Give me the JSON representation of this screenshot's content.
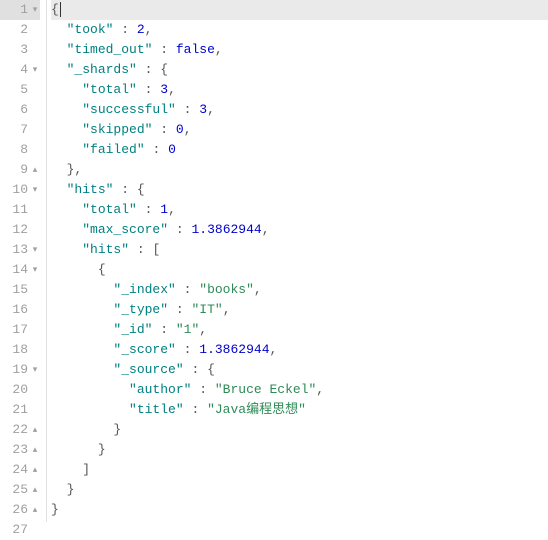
{
  "lines": [
    {
      "n": 1,
      "fold": "▾",
      "active": true,
      "tokens": [
        {
          "t": "brace",
          "v": "{"
        }
      ],
      "cursor_after": 0
    },
    {
      "n": 2,
      "fold": "",
      "active": false,
      "tokens": [
        {
          "t": "plain",
          "v": "  "
        },
        {
          "t": "key",
          "v": "\"took\""
        },
        {
          "t": "plain",
          "v": " "
        },
        {
          "t": "colon-sep",
          "v": ":"
        },
        {
          "t": "plain",
          "v": " "
        },
        {
          "t": "number",
          "v": "2"
        },
        {
          "t": "comma",
          "v": ","
        }
      ]
    },
    {
      "n": 3,
      "fold": "",
      "active": false,
      "tokens": [
        {
          "t": "plain",
          "v": "  "
        },
        {
          "t": "key",
          "v": "\"timed_out\""
        },
        {
          "t": "plain",
          "v": " "
        },
        {
          "t": "colon-sep",
          "v": ":"
        },
        {
          "t": "plain",
          "v": " "
        },
        {
          "t": "kw",
          "v": "false"
        },
        {
          "t": "comma",
          "v": ","
        }
      ]
    },
    {
      "n": 4,
      "fold": "▾",
      "active": false,
      "tokens": [
        {
          "t": "plain",
          "v": "  "
        },
        {
          "t": "key",
          "v": "\"_shards\""
        },
        {
          "t": "plain",
          "v": " "
        },
        {
          "t": "colon-sep",
          "v": ":"
        },
        {
          "t": "plain",
          "v": " "
        },
        {
          "t": "brace",
          "v": "{"
        }
      ]
    },
    {
      "n": 5,
      "fold": "",
      "active": false,
      "tokens": [
        {
          "t": "plain",
          "v": "    "
        },
        {
          "t": "key",
          "v": "\"total\""
        },
        {
          "t": "plain",
          "v": " "
        },
        {
          "t": "colon-sep",
          "v": ":"
        },
        {
          "t": "plain",
          "v": " "
        },
        {
          "t": "number",
          "v": "3"
        },
        {
          "t": "comma",
          "v": ","
        }
      ]
    },
    {
      "n": 6,
      "fold": "",
      "active": false,
      "tokens": [
        {
          "t": "plain",
          "v": "    "
        },
        {
          "t": "key",
          "v": "\"successful\""
        },
        {
          "t": "plain",
          "v": " "
        },
        {
          "t": "colon-sep",
          "v": ":"
        },
        {
          "t": "plain",
          "v": " "
        },
        {
          "t": "number",
          "v": "3"
        },
        {
          "t": "comma",
          "v": ","
        }
      ]
    },
    {
      "n": 7,
      "fold": "",
      "active": false,
      "tokens": [
        {
          "t": "plain",
          "v": "    "
        },
        {
          "t": "key",
          "v": "\"skipped\""
        },
        {
          "t": "plain",
          "v": " "
        },
        {
          "t": "colon-sep",
          "v": ":"
        },
        {
          "t": "plain",
          "v": " "
        },
        {
          "t": "number",
          "v": "0"
        },
        {
          "t": "comma",
          "v": ","
        }
      ]
    },
    {
      "n": 8,
      "fold": "",
      "active": false,
      "tokens": [
        {
          "t": "plain",
          "v": "    "
        },
        {
          "t": "key",
          "v": "\"failed\""
        },
        {
          "t": "plain",
          "v": " "
        },
        {
          "t": "colon-sep",
          "v": ":"
        },
        {
          "t": "plain",
          "v": " "
        },
        {
          "t": "number",
          "v": "0"
        }
      ]
    },
    {
      "n": 9,
      "fold": "▴",
      "active": false,
      "tokens": [
        {
          "t": "plain",
          "v": "  "
        },
        {
          "t": "brace",
          "v": "}"
        },
        {
          "t": "comma",
          "v": ","
        }
      ]
    },
    {
      "n": 10,
      "fold": "▾",
      "active": false,
      "tokens": [
        {
          "t": "plain",
          "v": "  "
        },
        {
          "t": "key",
          "v": "\"hits\""
        },
        {
          "t": "plain",
          "v": " "
        },
        {
          "t": "colon-sep",
          "v": ":"
        },
        {
          "t": "plain",
          "v": " "
        },
        {
          "t": "brace",
          "v": "{"
        }
      ]
    },
    {
      "n": 11,
      "fold": "",
      "active": false,
      "tokens": [
        {
          "t": "plain",
          "v": "    "
        },
        {
          "t": "key",
          "v": "\"total\""
        },
        {
          "t": "plain",
          "v": " "
        },
        {
          "t": "colon-sep",
          "v": ":"
        },
        {
          "t": "plain",
          "v": " "
        },
        {
          "t": "number",
          "v": "1"
        },
        {
          "t": "comma",
          "v": ","
        }
      ]
    },
    {
      "n": 12,
      "fold": "",
      "active": false,
      "tokens": [
        {
          "t": "plain",
          "v": "    "
        },
        {
          "t": "key",
          "v": "\"max_score\""
        },
        {
          "t": "plain",
          "v": " "
        },
        {
          "t": "colon-sep",
          "v": ":"
        },
        {
          "t": "plain",
          "v": " "
        },
        {
          "t": "number",
          "v": "1.3862944"
        },
        {
          "t": "comma",
          "v": ","
        }
      ]
    },
    {
      "n": 13,
      "fold": "▾",
      "active": false,
      "tokens": [
        {
          "t": "plain",
          "v": "    "
        },
        {
          "t": "key",
          "v": "\"hits\""
        },
        {
          "t": "plain",
          "v": " "
        },
        {
          "t": "colon-sep",
          "v": ":"
        },
        {
          "t": "plain",
          "v": " "
        },
        {
          "t": "bracket",
          "v": "["
        }
      ]
    },
    {
      "n": 14,
      "fold": "▾",
      "active": false,
      "tokens": [
        {
          "t": "plain",
          "v": "      "
        },
        {
          "t": "brace",
          "v": "{"
        }
      ]
    },
    {
      "n": 15,
      "fold": "",
      "active": false,
      "tokens": [
        {
          "t": "plain",
          "v": "        "
        },
        {
          "t": "key",
          "v": "\"_index\""
        },
        {
          "t": "plain",
          "v": " "
        },
        {
          "t": "colon-sep",
          "v": ":"
        },
        {
          "t": "plain",
          "v": " "
        },
        {
          "t": "string",
          "v": "\"books\""
        },
        {
          "t": "comma",
          "v": ","
        }
      ]
    },
    {
      "n": 16,
      "fold": "",
      "active": false,
      "tokens": [
        {
          "t": "plain",
          "v": "        "
        },
        {
          "t": "key",
          "v": "\"_type\""
        },
        {
          "t": "plain",
          "v": " "
        },
        {
          "t": "colon-sep",
          "v": ":"
        },
        {
          "t": "plain",
          "v": " "
        },
        {
          "t": "string",
          "v": "\"IT\""
        },
        {
          "t": "comma",
          "v": ","
        }
      ]
    },
    {
      "n": 17,
      "fold": "",
      "active": false,
      "tokens": [
        {
          "t": "plain",
          "v": "        "
        },
        {
          "t": "key",
          "v": "\"_id\""
        },
        {
          "t": "plain",
          "v": " "
        },
        {
          "t": "colon-sep",
          "v": ":"
        },
        {
          "t": "plain",
          "v": " "
        },
        {
          "t": "string",
          "v": "\"1\""
        },
        {
          "t": "comma",
          "v": ","
        }
      ]
    },
    {
      "n": 18,
      "fold": "",
      "active": false,
      "tokens": [
        {
          "t": "plain",
          "v": "        "
        },
        {
          "t": "key",
          "v": "\"_score\""
        },
        {
          "t": "plain",
          "v": " "
        },
        {
          "t": "colon-sep",
          "v": ":"
        },
        {
          "t": "plain",
          "v": " "
        },
        {
          "t": "number",
          "v": "1.3862944"
        },
        {
          "t": "comma",
          "v": ","
        }
      ]
    },
    {
      "n": 19,
      "fold": "▾",
      "active": false,
      "tokens": [
        {
          "t": "plain",
          "v": "        "
        },
        {
          "t": "key",
          "v": "\"_source\""
        },
        {
          "t": "plain",
          "v": " "
        },
        {
          "t": "colon-sep",
          "v": ":"
        },
        {
          "t": "plain",
          "v": " "
        },
        {
          "t": "brace",
          "v": "{"
        }
      ]
    },
    {
      "n": 20,
      "fold": "",
      "active": false,
      "tokens": [
        {
          "t": "plain",
          "v": "          "
        },
        {
          "t": "key",
          "v": "\"author\""
        },
        {
          "t": "plain",
          "v": " "
        },
        {
          "t": "colon-sep",
          "v": ":"
        },
        {
          "t": "plain",
          "v": " "
        },
        {
          "t": "string",
          "v": "\"Bruce Eckel\""
        },
        {
          "t": "comma",
          "v": ","
        }
      ]
    },
    {
      "n": 21,
      "fold": "",
      "active": false,
      "tokens": [
        {
          "t": "plain",
          "v": "          "
        },
        {
          "t": "key",
          "v": "\"title\""
        },
        {
          "t": "plain",
          "v": " "
        },
        {
          "t": "colon-sep",
          "v": ":"
        },
        {
          "t": "plain",
          "v": " "
        },
        {
          "t": "string",
          "v": "\"Java编程思想\""
        }
      ]
    },
    {
      "n": 22,
      "fold": "▴",
      "active": false,
      "tokens": [
        {
          "t": "plain",
          "v": "        "
        },
        {
          "t": "brace",
          "v": "}"
        }
      ]
    },
    {
      "n": 23,
      "fold": "▴",
      "active": false,
      "tokens": [
        {
          "t": "plain",
          "v": "      "
        },
        {
          "t": "brace",
          "v": "}"
        }
      ]
    },
    {
      "n": 24,
      "fold": "▴",
      "active": false,
      "tokens": [
        {
          "t": "plain",
          "v": "    "
        },
        {
          "t": "bracket",
          "v": "]"
        }
      ]
    },
    {
      "n": 25,
      "fold": "▴",
      "active": false,
      "tokens": [
        {
          "t": "plain",
          "v": "  "
        },
        {
          "t": "brace",
          "v": "}"
        }
      ]
    },
    {
      "n": 26,
      "fold": "▴",
      "active": false,
      "tokens": [
        {
          "t": "brace",
          "v": "}"
        }
      ]
    },
    {
      "n": 27,
      "fold": "",
      "active": false,
      "tokens": []
    }
  ]
}
